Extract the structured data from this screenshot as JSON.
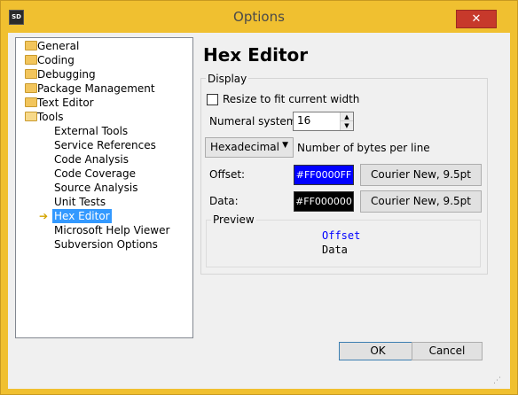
{
  "window": {
    "title": "Options",
    "app_icon": "SD"
  },
  "tree": {
    "top_level": [
      {
        "label": "General",
        "icon": "folder-icon"
      },
      {
        "label": "Coding",
        "icon": "folder-icon"
      },
      {
        "label": "Debugging",
        "icon": "folder-icon"
      },
      {
        "label": "Package Management",
        "icon": "folder-icon"
      },
      {
        "label": "Text Editor",
        "icon": "folder-icon"
      },
      {
        "label": "Tools",
        "icon": "folder-open-icon"
      }
    ],
    "tools_children": [
      "External Tools",
      "Service References",
      "Code Analysis",
      "Code Coverage",
      "Source Analysis",
      "Unit Tests",
      "Hex Editor",
      "Microsoft Help Viewer",
      "Subversion Options"
    ],
    "selected": "Hex Editor"
  },
  "panel": {
    "title": "Hex Editor",
    "group_label": "Display",
    "resize_label": "Resize to fit current width",
    "resize_checked": false,
    "numeral_label": "Numeral system:",
    "numeral_value": "16",
    "bytes_mode": "Hexadecimal",
    "bytes_label": "Number of bytes per line",
    "offset_label": "Offset:",
    "offset_color_text": "#FF0000FF",
    "offset_color": "#0000ff",
    "offset_font": "Courier New, 9.5pt",
    "data_label": "Data:",
    "data_color_text": "#FF000000",
    "data_color": "#000000",
    "data_font": "Courier New, 9.5pt",
    "preview_label": "Preview",
    "preview_offset": "Offset",
    "preview_data": "Data"
  },
  "buttons": {
    "ok": "OK",
    "cancel": "Cancel"
  },
  "colors": {
    "title_bar": "#f0c030",
    "close_button": "#c7392b",
    "selection": "#3399ff"
  }
}
